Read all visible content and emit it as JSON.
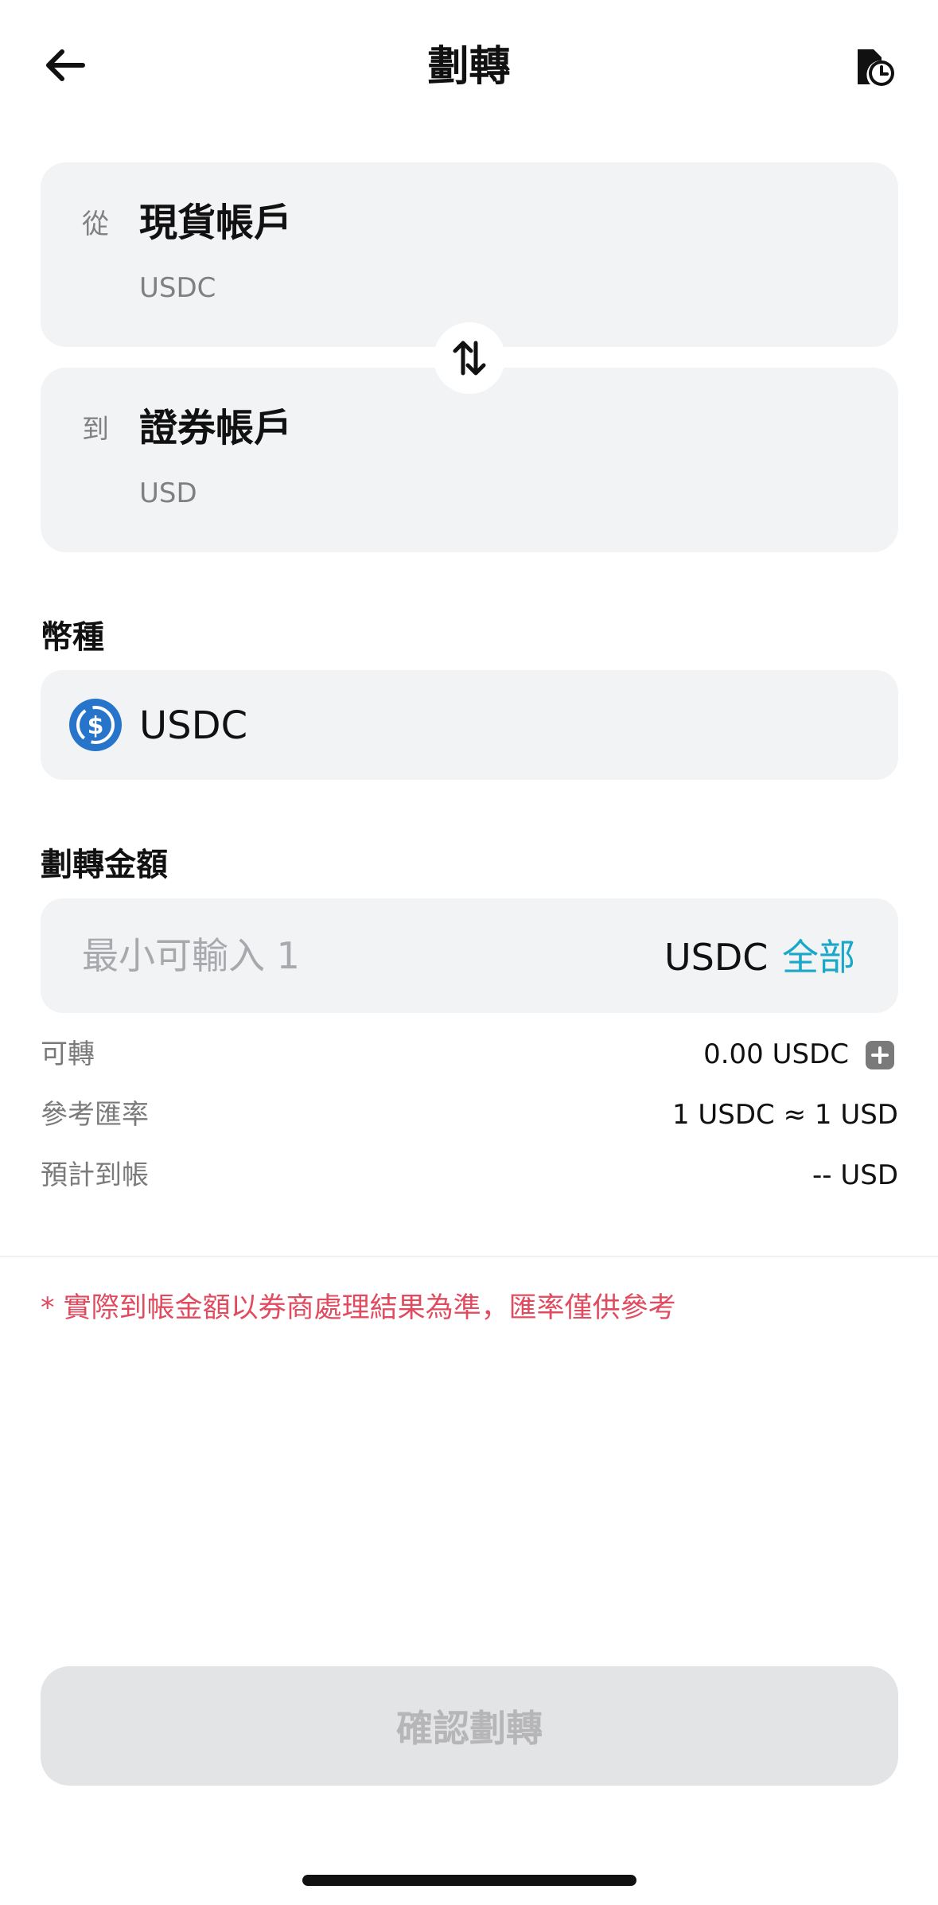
{
  "header": {
    "title": "劃轉",
    "back_icon": "arrow-left-icon",
    "history_icon": "transfer-history-icon"
  },
  "from_account": {
    "prefix": "從",
    "name": "現貨帳戶",
    "currency": "USDC"
  },
  "to_account": {
    "prefix": "到",
    "name": "證券帳戶",
    "currency": "USD"
  },
  "swap_icon": "swap-vertical-icon",
  "coin_section": {
    "label": "幣種",
    "selected": "USDC",
    "icon": "usdc-coin-icon"
  },
  "amount_section": {
    "label": "劃轉金額",
    "placeholder": "最小可輸入 1",
    "value": "",
    "unit": "USDC",
    "all_label": "全部"
  },
  "info": {
    "available_label": "可轉",
    "available_value": "0.00 USDC",
    "rate_label": "參考匯率",
    "rate_value": "1 USDC ≈ 1 USD",
    "expected_label": "預計到帳",
    "expected_value": "-- USD"
  },
  "notice": "* 實際到帳金額以券商處理結果為準，匯率僅供參考",
  "confirm_label": "確認劃轉",
  "colors": {
    "accent": "#1aa8c8",
    "warning": "#e04b5f",
    "card_bg": "#f2f3f5",
    "disabled_button_bg": "#e3e4e6",
    "usdc_blue": "#2775ca"
  }
}
